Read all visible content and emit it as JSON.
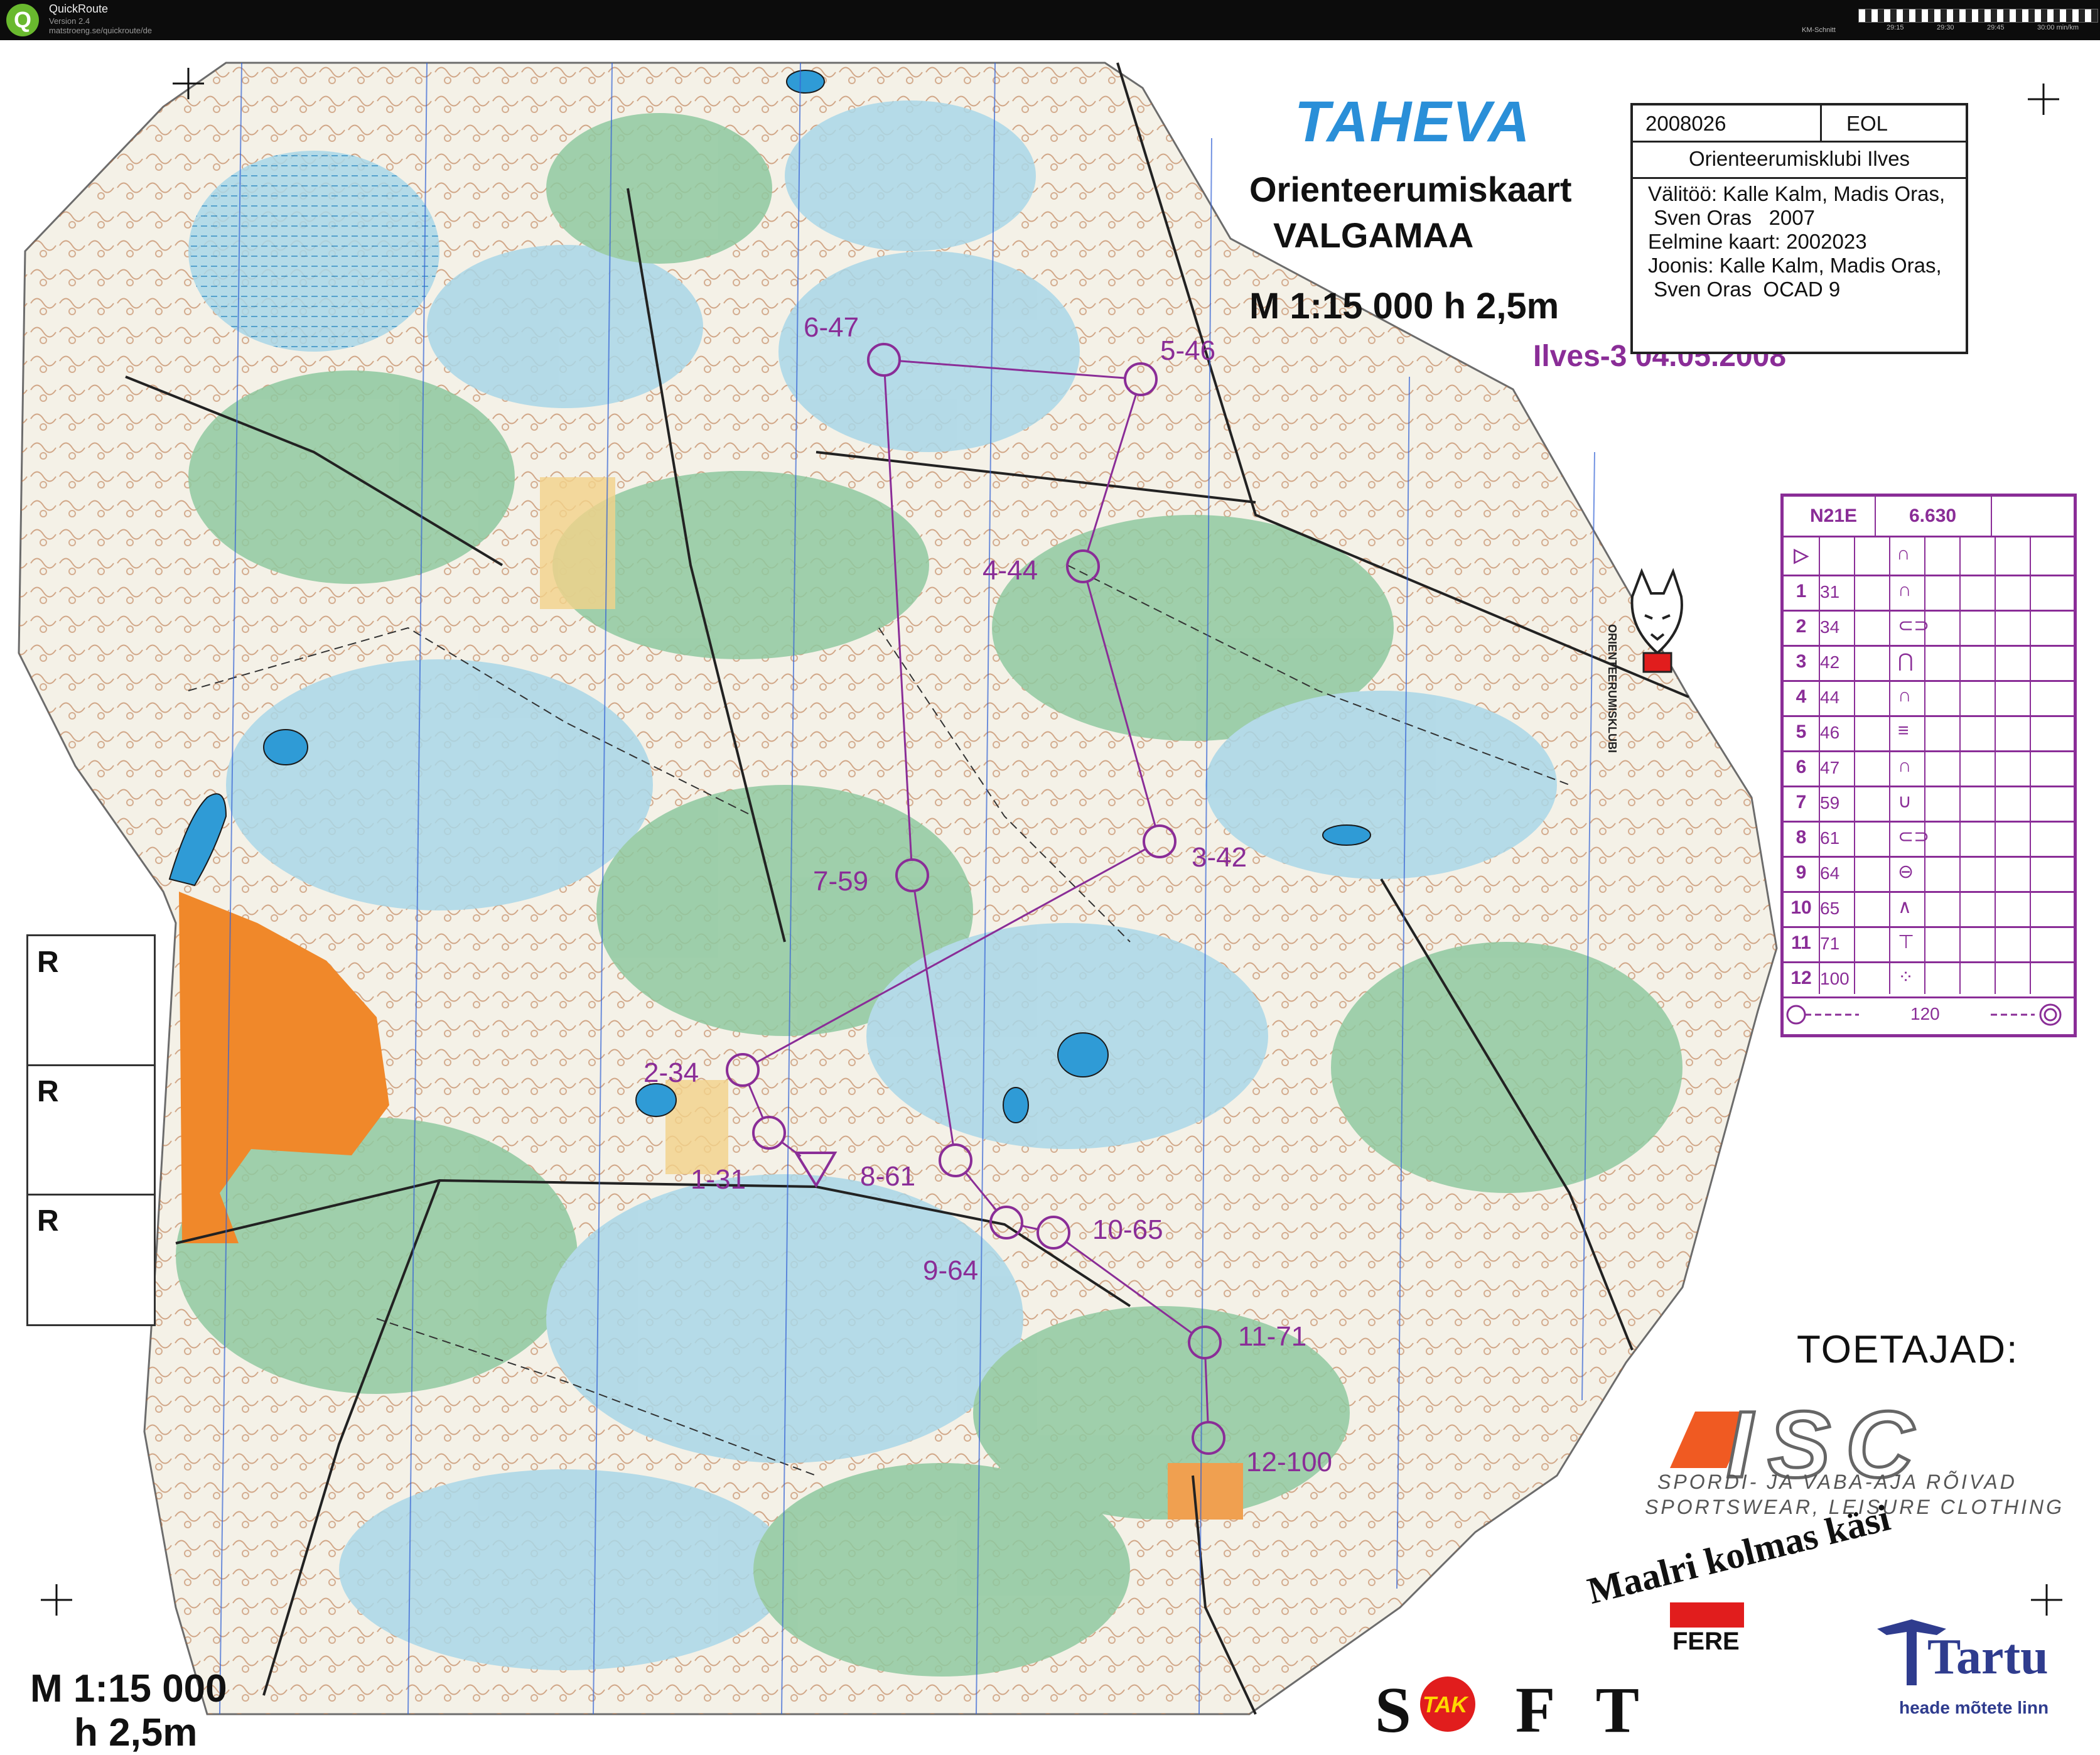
{
  "window": {
    "app_icon": "Q",
    "app_name": "QuickRoute",
    "version": "Version 2.4",
    "url": "matstroeng.se/quickroute/de",
    "timeline_label": "KM-Schnitt",
    "timeline_ticks": [
      "29:15",
      "29:30",
      "29:45",
      "30:00 min/km"
    ]
  },
  "map": {
    "title": "TAHEVA",
    "subtitle": "Orienteerumiskaart",
    "region": "VALGAMAA",
    "scale": "M 1:15  000 h 2,5m",
    "event": "Ilves-3 04.05.2008",
    "map_number": "2008026",
    "federation": "EOL",
    "club": "Orienteerumisklubi  Ilves",
    "credits": [
      "Välitöö: Kalle Kalm, Madis Oras,",
      " Sven Oras   2007",
      "Eelmine kaart: 2002023",
      "Joonis: Kalle Kalm, Madis Oras,",
      " Sven Oras  OCAD 9"
    ],
    "club_logo_text": "ORIENTEERUMISKLUBI",
    "scale_bottom_1": "M 1:15  000",
    "scale_bottom_2": "h 2,5m",
    "r_labels": [
      "R",
      "R",
      "R"
    ],
    "course_color": "#8a2d97",
    "title_color": "#2a8fd8"
  },
  "controls": [
    {
      "label": "1-31"
    },
    {
      "label": "2-34"
    },
    {
      "label": "3-42"
    },
    {
      "label": "4-44"
    },
    {
      "label": "5-46"
    },
    {
      "label": "6-47"
    },
    {
      "label": "7-59"
    },
    {
      "label": "8-61"
    },
    {
      "label": "9-64"
    },
    {
      "label": "10-65"
    },
    {
      "label": "11-71"
    },
    {
      "label": "12-100"
    }
  ],
  "control_descriptions": {
    "course": "N21E",
    "length": "6.630",
    "start_symbol": "▷",
    "rows": [
      {
        "num": "1",
        "code": "31"
      },
      {
        "num": "2",
        "code": "34"
      },
      {
        "num": "3",
        "code": "42"
      },
      {
        "num": "4",
        "code": "44"
      },
      {
        "num": "5",
        "code": "46"
      },
      {
        "num": "6",
        "code": "47"
      },
      {
        "num": "7",
        "code": "59"
      },
      {
        "num": "8",
        "code": "61"
      },
      {
        "num": "9",
        "code": "64"
      },
      {
        "num": "10",
        "code": "65"
      },
      {
        "num": "11",
        "code": "71"
      },
      {
        "num": "12",
        "code": "100"
      }
    ],
    "finish_distance": "120"
  },
  "sponsors": {
    "title": "TOETAJAD:",
    "isc_word": "ISC",
    "isc_line1": "SPORDI- JA VABA-AJA RÕIVAD",
    "isc_line2": "SPORTSWEAR, LEISURE CLOTHING",
    "maalri": "Maalri kolmas käsi",
    "fere": "FERE",
    "soft": "S   F T",
    "tak": "TAK",
    "tartu": "Tartu",
    "tartu_slogan": "heade mõtete linn"
  }
}
